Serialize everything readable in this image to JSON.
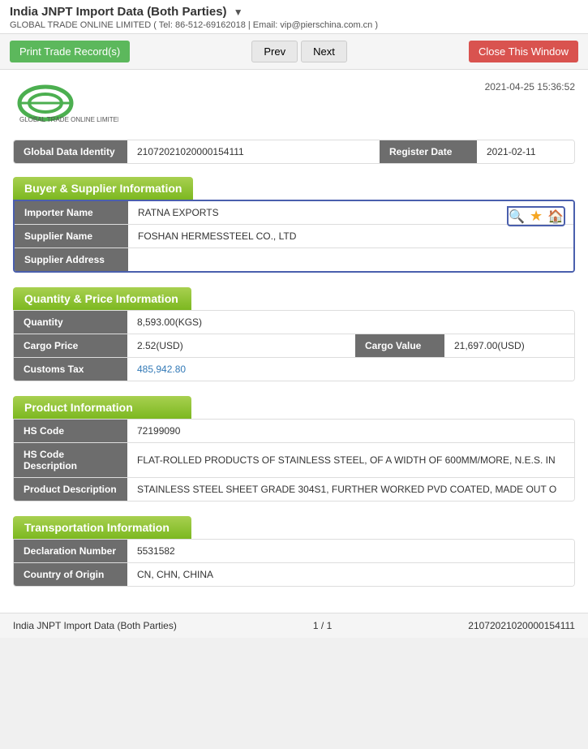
{
  "topBar": {
    "title": "India JNPT Import Data (Both Parties)",
    "dropdownArrow": "▼",
    "subtitle": "GLOBAL TRADE ONLINE LIMITED ( Tel: 86-512-69162018 | Email: vip@pierschina.com.cn )"
  },
  "toolbar": {
    "printLabel": "Print Trade Record(s)",
    "prevLabel": "Prev",
    "nextLabel": "Next",
    "closeLabel": "Close This Window"
  },
  "record": {
    "timestamp": "2021-04-25 15:36:52",
    "globalDataIdentityLabel": "Global Data Identity",
    "globalDataIdentityValue": "21072021020000154111",
    "registerDateLabel": "Register Date",
    "registerDateValue": "2021-02-11"
  },
  "buyerSupplierSection": {
    "title": "Buyer & Supplier Information",
    "importerNameLabel": "Importer Name",
    "importerNameValue": "RATNA EXPORTS",
    "supplierNameLabel": "Supplier Name",
    "supplierNameValue": "FOSHAN HERMESSTEEL CO., LTD",
    "supplierAddressLabel": "Supplier Address",
    "supplierAddressValue": "",
    "icons": {
      "searchIcon": "🔍",
      "starIcon": "★",
      "homeIcon": "🏠"
    }
  },
  "quantityPriceSection": {
    "title": "Quantity & Price Information",
    "quantityLabel": "Quantity",
    "quantityValue": "8,593.00(KGS)",
    "cargoPriceLabel": "Cargo Price",
    "cargoPriceValue": "2.52(USD)",
    "cargoValueLabel": "Cargo Value",
    "cargoValueValue": "21,697.00(USD)",
    "customsTaxLabel": "Customs Tax",
    "customsTaxValue": "485,942.80"
  },
  "productSection": {
    "title": "Product Information",
    "hsCodeLabel": "HS Code",
    "hsCodeValue": "72199090",
    "hsCodeDescLabel": "HS Code Description",
    "hsCodeDescValue": "FLAT-ROLLED PRODUCTS OF STAINLESS STEEL, OF A WIDTH OF 600MM/MORE, N.E.S. IN",
    "productDescLabel": "Product Description",
    "productDescValue": "STAINLESS STEEL SHEET GRADE 304S1, FURTHER WORKED PVD COATED, MADE OUT O"
  },
  "transportationSection": {
    "title": "Transportation Information",
    "declarationNumberLabel": "Declaration Number",
    "declarationNumberValue": "5531582",
    "countryOfOriginLabel": "Country of Origin",
    "countryOfOriginValue": "CN, CHN, CHINA"
  },
  "footer": {
    "pageInfo": "India JNPT Import Data (Both Parties)",
    "pagination": "1 / 1",
    "recordId": "21072021020000154111"
  }
}
